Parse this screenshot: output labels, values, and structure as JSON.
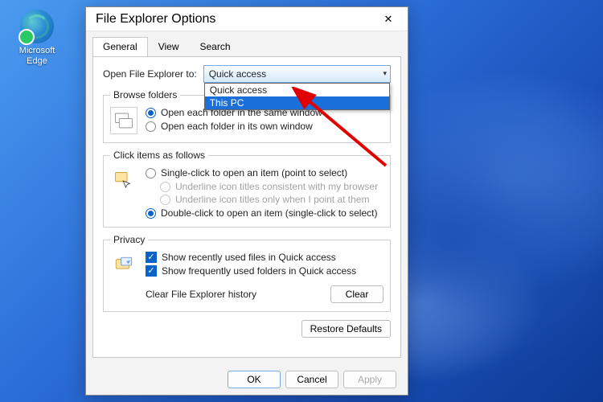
{
  "desktop": {
    "edge_label": "Microsoft\nEdge"
  },
  "dialog": {
    "title": "File Explorer Options",
    "tabs": {
      "general": "General",
      "view": "View",
      "search": "Search"
    },
    "open_to_label": "Open File Explorer to:",
    "combo_selected": "Quick access",
    "dropdown": {
      "opt0": "Quick access",
      "opt1": "This PC"
    },
    "browse": {
      "legend": "Browse folders",
      "same": "Open each folder in the same window",
      "own": "Open each folder in its own window"
    },
    "click": {
      "legend": "Click items as follows",
      "single": "Single-click to open an item (point to select)",
      "u_browser": "Underline icon titles consistent with my browser",
      "u_point": "Underline icon titles only when I point at them",
      "double": "Double-click to open an item (single-click to select)"
    },
    "privacy": {
      "legend": "Privacy",
      "recent": "Show recently used files in Quick access",
      "frequent": "Show frequently used folders in Quick access",
      "clear_label": "Clear File Explorer history",
      "clear_btn": "Clear"
    },
    "restore": "Restore Defaults",
    "ok": "OK",
    "cancel": "Cancel",
    "apply": "Apply"
  }
}
